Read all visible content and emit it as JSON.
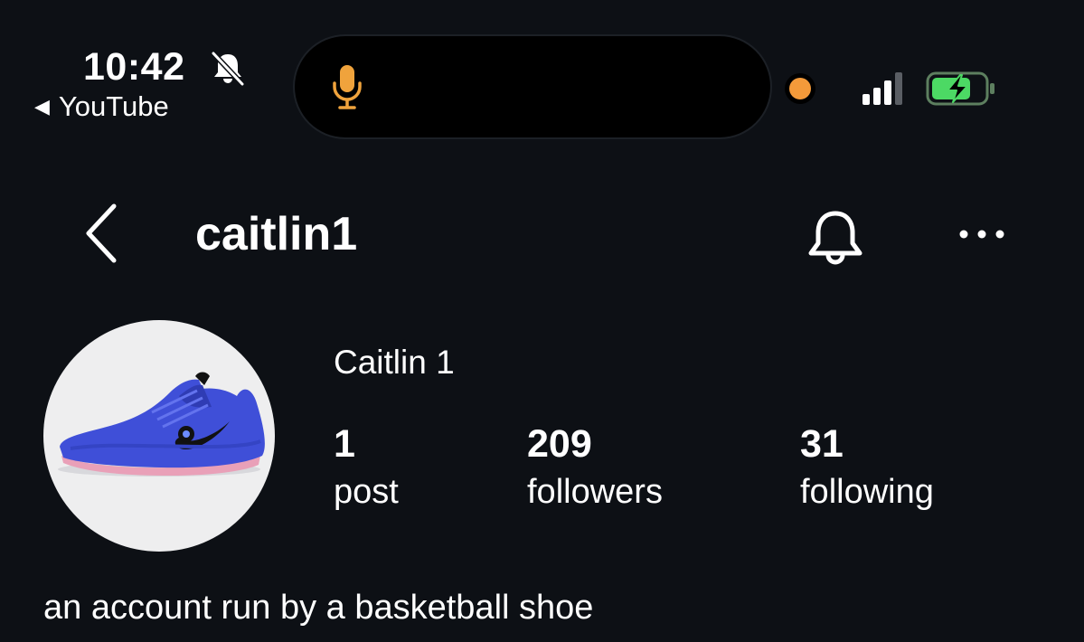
{
  "status_bar": {
    "time": "10:42",
    "back_app": "YouTube",
    "back_glyph": "◀",
    "icons": [
      "bell-slash-icon",
      "microphone-icon",
      "recording-dot-icon",
      "cellular-signal-icon",
      "battery-charging-icon"
    ],
    "mic_color": "#f0a33c",
    "battery_color": "#4cd964",
    "battery_level": 0.75
  },
  "nav": {
    "username": "caitlin1",
    "icons": [
      "back-chevron-icon",
      "notification-bell-icon",
      "more-options-icon"
    ]
  },
  "profile": {
    "avatar_description_icon": "basketball-shoe-icon",
    "display_name": "Caitlin 1",
    "stats": [
      {
        "value": "1",
        "label": "post"
      },
      {
        "value": "209",
        "label": "followers"
      },
      {
        "value": "31",
        "label": "following"
      }
    ],
    "bio": "an account run by a basketball shoe"
  },
  "colors": {
    "background": "#0d1015",
    "text": "#ffffff",
    "shoe": "#3f4fd8"
  }
}
